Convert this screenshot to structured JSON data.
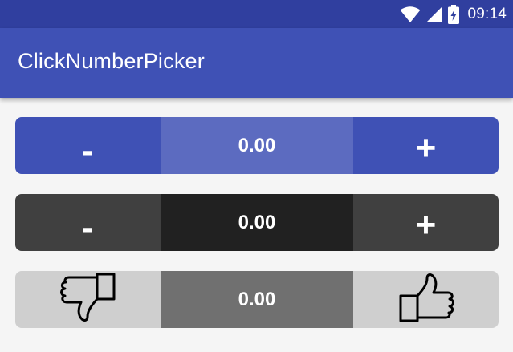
{
  "status_bar": {
    "time": "09:14",
    "icons": [
      "wifi-icon",
      "signal-icon",
      "battery-charging-icon"
    ]
  },
  "app_bar": {
    "title": "ClickNumberPicker"
  },
  "pickers": [
    {
      "style": "blue",
      "decrement_label": "-",
      "increment_label": "+",
      "value": "0.00",
      "colors": {
        "buttons": "#3f51b5",
        "value_bg": "#5c6bc0"
      }
    },
    {
      "style": "dark",
      "decrement_label": "-",
      "increment_label": "+",
      "value": "0.00",
      "colors": {
        "buttons": "#404040",
        "value_bg": "#212121"
      }
    },
    {
      "style": "thumbs",
      "decrement_icon": "thumbs-down-icon",
      "increment_icon": "thumbs-up-icon",
      "value": "0.00",
      "colors": {
        "buttons": "#cfcfcf",
        "value_bg": "#707070"
      }
    }
  ],
  "colors": {
    "primary": "#3f51b5",
    "primary_dark": "#303f9f",
    "background": "#f5f5f5"
  }
}
